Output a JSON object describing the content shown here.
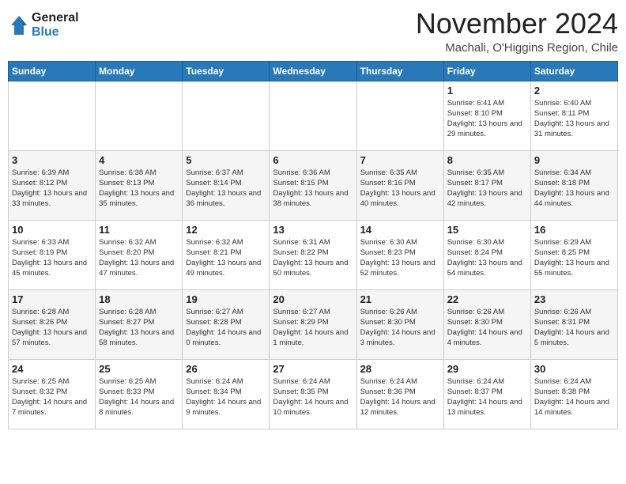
{
  "header": {
    "logo_line1": "General",
    "logo_line2": "Blue",
    "month_title": "November 2024",
    "location": "Machali, O'Higgins Region, Chile"
  },
  "weekdays": [
    "Sunday",
    "Monday",
    "Tuesday",
    "Wednesday",
    "Thursday",
    "Friday",
    "Saturday"
  ],
  "weeks": [
    [
      {
        "day": "",
        "info": ""
      },
      {
        "day": "",
        "info": ""
      },
      {
        "day": "",
        "info": ""
      },
      {
        "day": "",
        "info": ""
      },
      {
        "day": "",
        "info": ""
      },
      {
        "day": "1",
        "info": "Sunrise: 6:41 AM\nSunset: 8:10 PM\nDaylight: 13 hours and 29 minutes."
      },
      {
        "day": "2",
        "info": "Sunrise: 6:40 AM\nSunset: 8:11 PM\nDaylight: 13 hours and 31 minutes."
      }
    ],
    [
      {
        "day": "3",
        "info": "Sunrise: 6:39 AM\nSunset: 8:12 PM\nDaylight: 13 hours and 33 minutes."
      },
      {
        "day": "4",
        "info": "Sunrise: 6:38 AM\nSunset: 8:13 PM\nDaylight: 13 hours and 35 minutes."
      },
      {
        "day": "5",
        "info": "Sunrise: 6:37 AM\nSunset: 8:14 PM\nDaylight: 13 hours and 36 minutes."
      },
      {
        "day": "6",
        "info": "Sunrise: 6:36 AM\nSunset: 8:15 PM\nDaylight: 13 hours and 38 minutes."
      },
      {
        "day": "7",
        "info": "Sunrise: 6:35 AM\nSunset: 8:16 PM\nDaylight: 13 hours and 40 minutes."
      },
      {
        "day": "8",
        "info": "Sunrise: 6:35 AM\nSunset: 8:17 PM\nDaylight: 13 hours and 42 minutes."
      },
      {
        "day": "9",
        "info": "Sunrise: 6:34 AM\nSunset: 8:18 PM\nDaylight: 13 hours and 44 minutes."
      }
    ],
    [
      {
        "day": "10",
        "info": "Sunrise: 6:33 AM\nSunset: 8:19 PM\nDaylight: 13 hours and 45 minutes."
      },
      {
        "day": "11",
        "info": "Sunrise: 6:32 AM\nSunset: 8:20 PM\nDaylight: 13 hours and 47 minutes."
      },
      {
        "day": "12",
        "info": "Sunrise: 6:32 AM\nSunset: 8:21 PM\nDaylight: 13 hours and 49 minutes."
      },
      {
        "day": "13",
        "info": "Sunrise: 6:31 AM\nSunset: 8:22 PM\nDaylight: 13 hours and 50 minutes."
      },
      {
        "day": "14",
        "info": "Sunrise: 6:30 AM\nSunset: 8:23 PM\nDaylight: 13 hours and 52 minutes."
      },
      {
        "day": "15",
        "info": "Sunrise: 6:30 AM\nSunset: 8:24 PM\nDaylight: 13 hours and 54 minutes."
      },
      {
        "day": "16",
        "info": "Sunrise: 6:29 AM\nSunset: 8:25 PM\nDaylight: 13 hours and 55 minutes."
      }
    ],
    [
      {
        "day": "17",
        "info": "Sunrise: 6:28 AM\nSunset: 8:26 PM\nDaylight: 13 hours and 57 minutes."
      },
      {
        "day": "18",
        "info": "Sunrise: 6:28 AM\nSunset: 8:27 PM\nDaylight: 13 hours and 58 minutes."
      },
      {
        "day": "19",
        "info": "Sunrise: 6:27 AM\nSunset: 8:28 PM\nDaylight: 14 hours and 0 minutes."
      },
      {
        "day": "20",
        "info": "Sunrise: 6:27 AM\nSunset: 8:29 PM\nDaylight: 14 hours and 1 minute."
      },
      {
        "day": "21",
        "info": "Sunrise: 6:26 AM\nSunset: 8:30 PM\nDaylight: 14 hours and 3 minutes."
      },
      {
        "day": "22",
        "info": "Sunrise: 6:26 AM\nSunset: 8:30 PM\nDaylight: 14 hours and 4 minutes."
      },
      {
        "day": "23",
        "info": "Sunrise: 6:26 AM\nSunset: 8:31 PM\nDaylight: 14 hours and 5 minutes."
      }
    ],
    [
      {
        "day": "24",
        "info": "Sunrise: 6:25 AM\nSunset: 8:32 PM\nDaylight: 14 hours and 7 minutes."
      },
      {
        "day": "25",
        "info": "Sunrise: 6:25 AM\nSunset: 8:33 PM\nDaylight: 14 hours and 8 minutes."
      },
      {
        "day": "26",
        "info": "Sunrise: 6:24 AM\nSunset: 8:34 PM\nDaylight: 14 hours and 9 minutes."
      },
      {
        "day": "27",
        "info": "Sunrise: 6:24 AM\nSunset: 8:35 PM\nDaylight: 14 hours and 10 minutes."
      },
      {
        "day": "28",
        "info": "Sunrise: 6:24 AM\nSunset: 8:36 PM\nDaylight: 14 hours and 12 minutes."
      },
      {
        "day": "29",
        "info": "Sunrise: 6:24 AM\nSunset: 8:37 PM\nDaylight: 14 hours and 13 minutes."
      },
      {
        "day": "30",
        "info": "Sunrise: 6:24 AM\nSunset: 8:38 PM\nDaylight: 14 hours and 14 minutes."
      }
    ]
  ]
}
